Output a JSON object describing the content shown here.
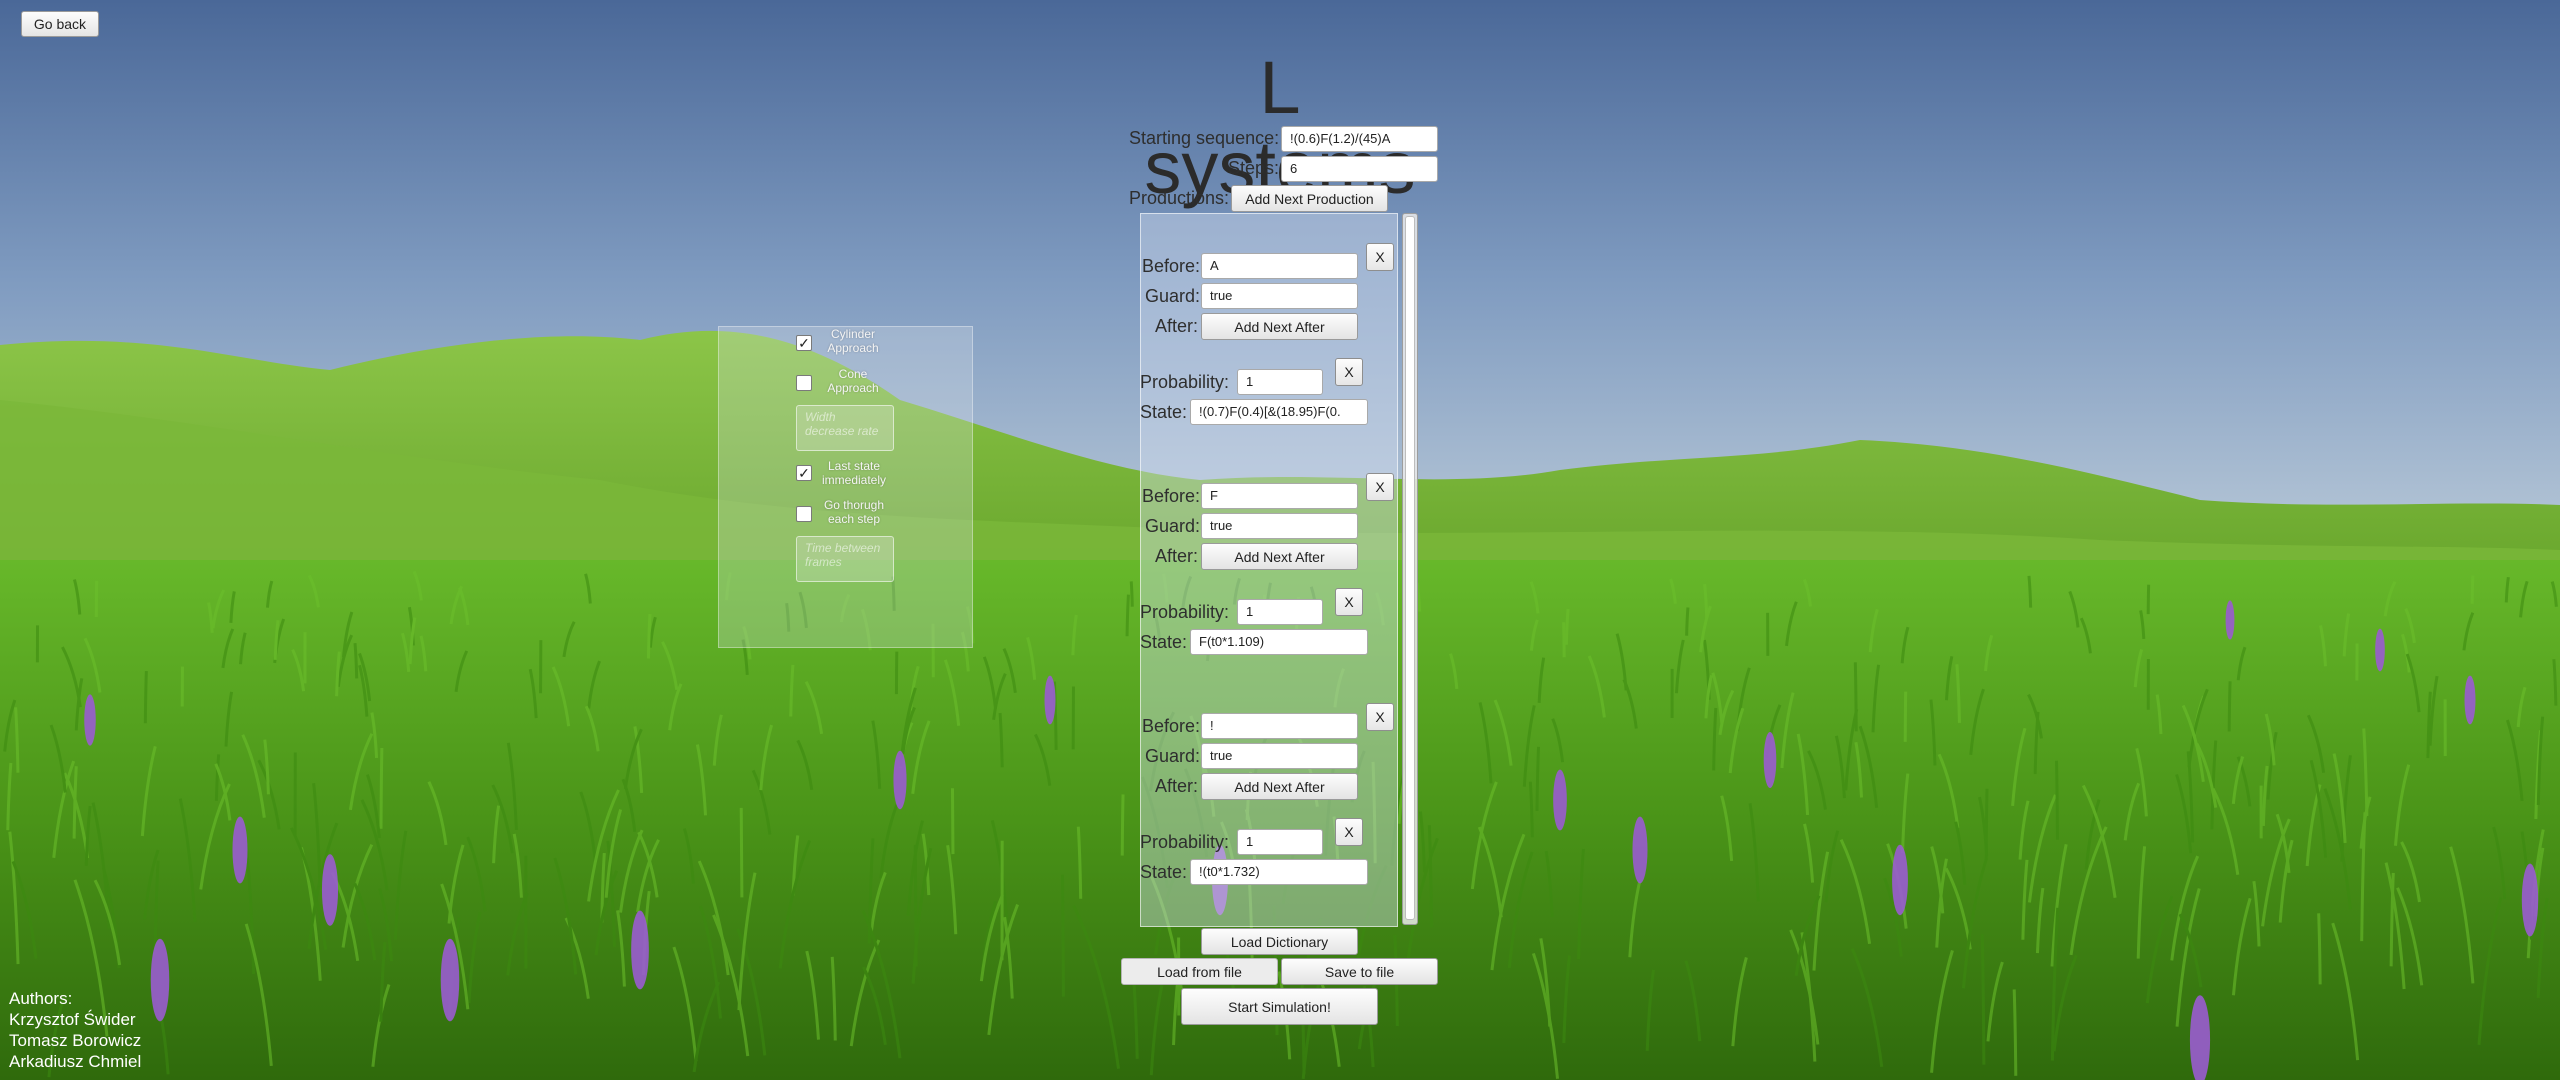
{
  "header": {
    "go_back": "Go back",
    "title": "L systems"
  },
  "form": {
    "starting_sequence_label": "Starting sequence:",
    "starting_sequence_value": "!(0.6)F(1.2)/(45)A",
    "steps_label": "Steps:",
    "steps_value": "6",
    "productions_label": "Productions:",
    "add_next_production": "Add Next Production"
  },
  "productions": [
    {
      "before_label": "Before:",
      "before": "A",
      "guard_label": "Guard:",
      "guard": "true",
      "after_label": "After:",
      "add_next_after": "Add Next After",
      "probability_label": "Probability:",
      "probability": "1",
      "state_label": "State:",
      "state": "!(0.7)F(0.4)[&(18.95)F(0.",
      "remove": "X",
      "remove_after": "X"
    },
    {
      "before_label": "Before:",
      "before": "F",
      "guard_label": "Guard:",
      "guard": "true",
      "after_label": "After:",
      "add_next_after": "Add Next After",
      "probability_label": "Probability:",
      "probability": "1",
      "state_label": "State:",
      "state": "F(t0*1.109)",
      "remove": "X",
      "remove_after": "X"
    },
    {
      "before_label": "Before:",
      "before": "!",
      "guard_label": "Guard:",
      "guard": "true",
      "after_label": "After:",
      "add_next_after": "Add Next After",
      "probability_label": "Probability:",
      "probability": "1",
      "state_label": "State:",
      "state": "!(t0*1.732)",
      "remove": "X",
      "remove_after": "X"
    }
  ],
  "options": {
    "cylinder_approach": {
      "label": "Cylinder Approach",
      "checked": true
    },
    "cone_approach": {
      "label": "Cone Approach",
      "checked": false
    },
    "width_decrease_placeholder": "Width decrease rate",
    "last_state_immediately": {
      "label": "Last state immediately",
      "checked": true
    },
    "go_through_each_step": {
      "label": "Go thorugh each step",
      "checked": false
    },
    "time_between_frames_placeholder": "Time between frames"
  },
  "footer": {
    "load_dictionary": "Load Dictionary",
    "load_from_file": "Load from file",
    "save_to_file": "Save to file",
    "start_simulation": "Start Simulation!"
  },
  "authors": {
    "heading": "Authors:",
    "names": [
      "Krzysztof Świder",
      "Tomasz Borowicz",
      "Arkadiusz Chmiel"
    ]
  },
  "colors": {
    "sky_top": "#4a6898",
    "sky_horizon": "#b9c9d8",
    "grass": "#4f9a1a",
    "flowers": "#9a5cd0"
  }
}
